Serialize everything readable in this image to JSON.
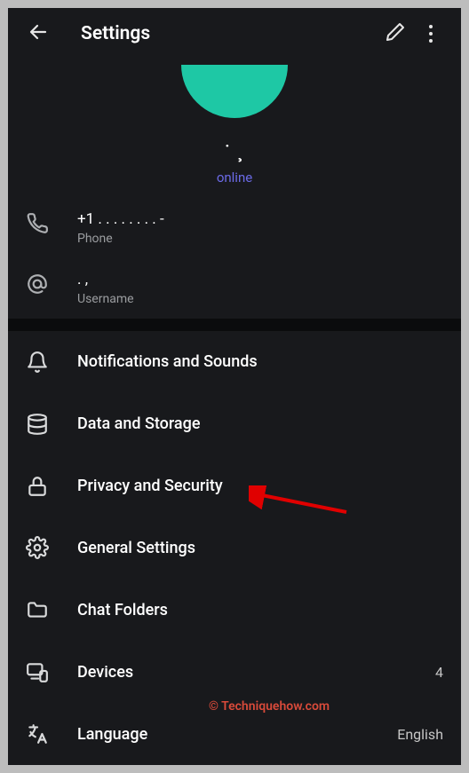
{
  "header": {
    "title": "Settings"
  },
  "profile": {
    "name": "˙ ¸",
    "status": "online"
  },
  "info": {
    "phone_value": "+1 . . .   . . .  . . -",
    "phone_label": "Phone",
    "username_value": "      . ,",
    "username_label": "Username"
  },
  "menu": {
    "notifications": "Notifications and Sounds",
    "data": "Data and Storage",
    "privacy": "Privacy and Security",
    "general": "General Settings",
    "folders": "Chat Folders",
    "devices": "Devices",
    "devices_count": "4",
    "language": "Language",
    "language_value": "English"
  },
  "watermark": "© Techniquehow.com"
}
